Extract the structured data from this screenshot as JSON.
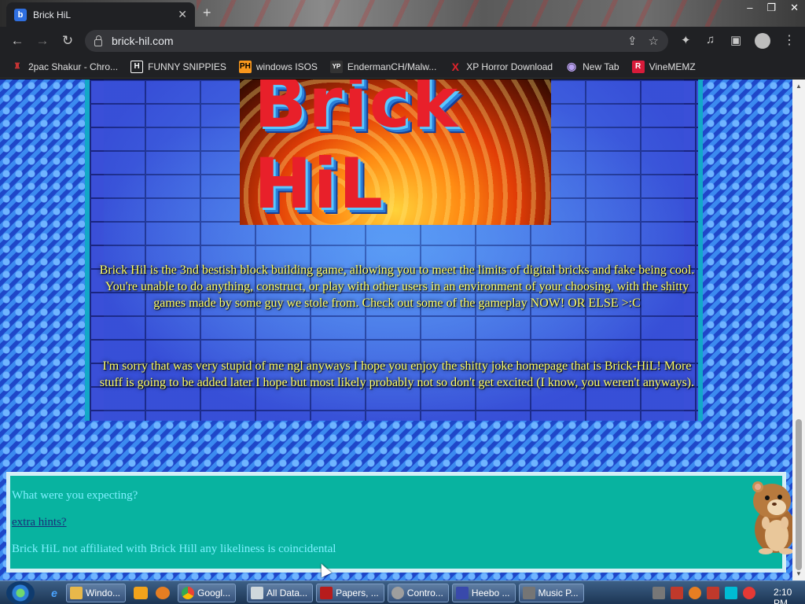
{
  "browser": {
    "tab_title": "Brick HiL",
    "tab_favicon": "b",
    "new_tab_icon": "+",
    "window_controls": [
      "–",
      "❐",
      "✕"
    ],
    "url": "brick-hil.com",
    "icons": {
      "back": "←",
      "forward": "→",
      "reload": "↻",
      "share": "⇪",
      "star": "☆",
      "extensions": "✦",
      "media": "♫",
      "sidebar": "▣",
      "menu": "⋮"
    }
  },
  "bookmarks": [
    {
      "label": "2pac Shakur - Chro...",
      "icon": "♜",
      "color": "#c83434"
    },
    {
      "label": "FUNNY SNIPPIES",
      "icon": "H",
      "color": "#ffffff"
    },
    {
      "label": "windows ISOS",
      "icon": "PH",
      "color": "#f7971d"
    },
    {
      "label": "EndermanCH/Malw...",
      "icon": "YP",
      "color": "#ffffff"
    },
    {
      "label": "XP Horror Download",
      "icon": "X",
      "color": "#e3232b"
    },
    {
      "label": "New Tab",
      "icon": "◉",
      "color": "#8a6bd8"
    },
    {
      "label": "VineMEMZ",
      "icon": "R",
      "color": "#d81b3a"
    }
  ],
  "page": {
    "logo_text": "Brick HiL",
    "paragraph1": "Brick Hil is the 3nd bestish block building game, allowing you to meet the limits of digital bricks and fake being cool. You're unable to do anything, construct, or play with other users in an environment of your choosing, with the shitty games made by some guy we stole from. Check out some of the gameplay NOW! OR ELSE >:C",
    "paragraph2": "I'm sorry that was very stupid of me ngl anyways I hope you enjoy the shitty joke homepage that is Brick-HiL! More stuff is going to be added later I hope but most likely probably not so don't get excited (I know, you weren't anyways).",
    "footer": {
      "question": "What were you expecting?",
      "hint_link": "extra hints?",
      "disclaimer": "Brick HiL not affiliated with Brick Hill any likeliness is coincidental"
    }
  },
  "scrollbar": {
    "up": "▲",
    "down": "▼"
  },
  "taskbar": {
    "apps": [
      {
        "label": "Windo...",
        "color": "#e8b84a"
      },
      {
        "label": "Googl...",
        "color": "#4caf50"
      },
      {
        "label": "All Data...",
        "color": "#cfd8dc"
      },
      {
        "label": "Papers, ...",
        "color": "#b71c1c"
      },
      {
        "label": "Contro...",
        "color": "#9e9e9e"
      },
      {
        "label": "Heebo ...",
        "color": "#3949ab"
      },
      {
        "label": "Music P...",
        "color": "#757575"
      }
    ],
    "clock": "2:10 PM"
  }
}
